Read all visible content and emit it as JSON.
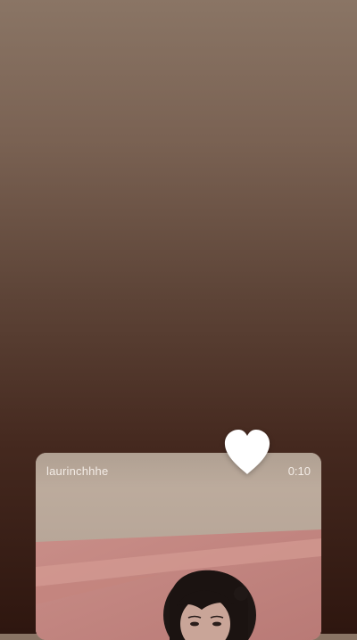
{
  "story": {
    "username": "laurinchhhe",
    "duration": "0:10"
  },
  "icons": {
    "like": "heart-icon"
  },
  "colors": {
    "background_top": "#8a7565",
    "background_bottom": "#2e160f",
    "heart": "#ffffff",
    "text": "#f3ece6"
  }
}
